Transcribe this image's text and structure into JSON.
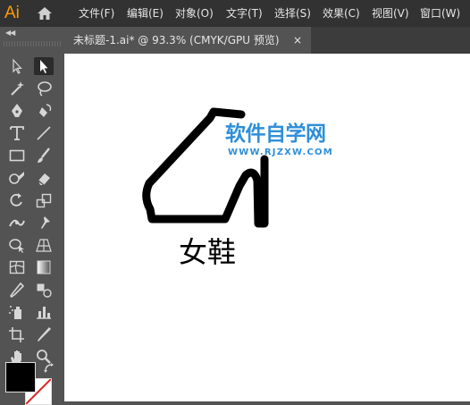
{
  "app": {
    "logo": "Ai"
  },
  "menu": [
    "文件(F)",
    "编辑(E)",
    "对象(O)",
    "文字(T)",
    "选择(S)",
    "效果(C)",
    "视图(V)",
    "窗口(W)"
  ],
  "document": {
    "tab_title": "未标题-1.ai* @ 93.3% (CMYK/GPU 预览)",
    "close_glyph": "×"
  },
  "toolbox": {
    "collapse_glyph": "◀◀",
    "selected_tool": "direct-selection-tool",
    "fill_color": "#000000",
    "stroke_color": "#ffffff"
  },
  "artwork": {
    "label": "女鞋",
    "shape": "high-heel-shoe-icon"
  },
  "watermark": {
    "title": "软件自学网",
    "url": "WWW.RJZXW.COM",
    "color": "#2f8fd8"
  }
}
